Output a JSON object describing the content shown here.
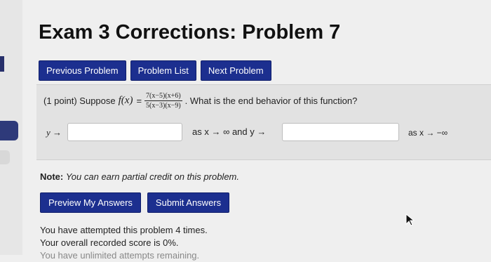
{
  "page": {
    "title": "Exam 3 Corrections: Problem 7"
  },
  "nav": {
    "previous": "Previous Problem",
    "list": "Problem List",
    "next": "Next Problem"
  },
  "problem": {
    "points": "(1 point) Suppose",
    "function_name": "f(x)",
    "equals": "=",
    "numerator": "7(x−5)(x+6)",
    "denominator": "5(x−3)(x−9)",
    "question": ". What is the end behavior of this function?",
    "y_arrow_1": "y →",
    "answer_1_value": "",
    "middle_text": "as x → ∞ and y →",
    "answer_2_value": "",
    "end_text": "as x → −∞"
  },
  "note": {
    "label": "Note:",
    "text": "You can earn partial credit on this problem."
  },
  "actions": {
    "preview": "Preview My Answers",
    "submit": "Submit Answers"
  },
  "status": {
    "attempts": "You have attempted this problem 4 times.",
    "score": "Your overall recorded score is 0%.",
    "remaining": "You have unlimited attempts remaining."
  }
}
